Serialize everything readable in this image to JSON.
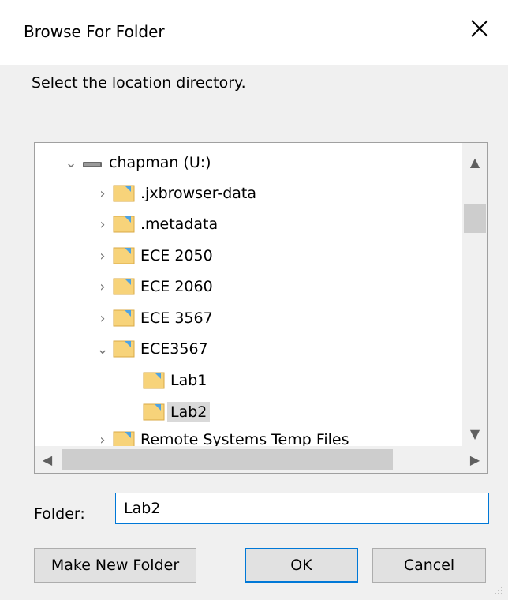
{
  "dialog": {
    "title": "Browse For Folder",
    "prompt": "Select the location directory."
  },
  "tree": {
    "items": [
      {
        "label": "chapman (U:)",
        "level": 0,
        "expanded": true,
        "icon": "drive-icon"
      },
      {
        "label": ".jxbrowser-data",
        "level": 1,
        "expanded": false,
        "icon": "folder-icon"
      },
      {
        "label": ".metadata",
        "level": 1,
        "expanded": false,
        "icon": "folder-icon"
      },
      {
        "label": "ECE 2050",
        "level": 1,
        "expanded": false,
        "icon": "folder-icon"
      },
      {
        "label": "ECE 2060",
        "level": 1,
        "expanded": false,
        "icon": "folder-icon"
      },
      {
        "label": "ECE 3567",
        "level": 1,
        "expanded": false,
        "icon": "folder-icon"
      },
      {
        "label": "ECE3567",
        "level": 1,
        "expanded": true,
        "icon": "folder-icon"
      },
      {
        "label": "Lab1",
        "level": 2,
        "expanded": null,
        "icon": "folder-icon"
      },
      {
        "label": "Lab2",
        "level": 2,
        "expanded": null,
        "icon": "folder-icon",
        "selected": true
      },
      {
        "label": "Remote Systems Temp Files",
        "level": 1,
        "expanded": false,
        "icon": "folder-icon"
      }
    ]
  },
  "folder_field": {
    "label": "Folder:",
    "value": "Lab2"
  },
  "buttons": {
    "make_new_folder": "Make New Folder",
    "ok": "OK",
    "cancel": "Cancel"
  },
  "colors": {
    "accent": "#0078d7",
    "folder": "#f7d37a",
    "selection": "#d9d9d9"
  }
}
